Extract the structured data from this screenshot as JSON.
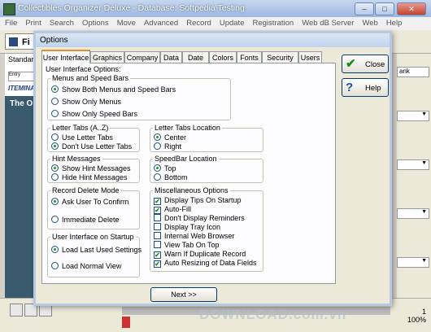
{
  "app": {
    "title": "Collectibles Organizer Deluxe - Database: Softpedia Testing",
    "window_buttons": [
      "–",
      "□",
      "✕"
    ],
    "menu": [
      "File",
      "Print",
      "Search",
      "Options",
      "Move",
      "Advanced",
      "Record",
      "Update",
      "Registration",
      "Web dB Server",
      "Web",
      "Help"
    ],
    "toolbar_fbtn_label": "Fi",
    "left_standard": "Standarc",
    "left_entry": "Entry",
    "left_itemnav": "ITEMINA",
    "left_dark_title": "The O",
    "right_rank": "ank",
    "zoom_level": "1\n100%"
  },
  "dialog": {
    "title": "Options",
    "tabs": [
      "User Interface",
      "Graphics",
      "Company",
      "Data",
      "Date",
      "Colors",
      "Fonts",
      "Security",
      "Users"
    ],
    "active_tab": "User Interface",
    "pane_caption": "User Interface Options:",
    "groups": {
      "menus": {
        "label": "Menus and Speed Bars",
        "options": [
          "Show Both Menus and Speed Bars",
          "Show Only Menus",
          "Show Only Speed Bars"
        ],
        "selected": 0
      },
      "letter_tabs": {
        "label": "Letter Tabs (A..Z)",
        "options": [
          "Use Letter Tabs",
          "Don't Use Letter Tabs"
        ],
        "selected": 1
      },
      "letter_tabs_location": {
        "label": "Letter Tabs Location",
        "options": [
          "Center",
          "Right"
        ],
        "selected": 0
      },
      "hint_messages": {
        "label": "Hint Messages",
        "options": [
          "Show Hint Messages",
          "Hide Hint Messages"
        ],
        "selected": 0
      },
      "speedbar_location": {
        "label": "SpeedBar Location",
        "options": [
          "Top",
          "Bottom"
        ],
        "selected": 0
      },
      "record_delete": {
        "label": "Record Delete Mode",
        "options": [
          "Ask User To Confirm",
          "Immediate Delete"
        ],
        "selected": 0
      },
      "startup": {
        "label": "User Interface on Startup",
        "options": [
          "Load Last Used Settings",
          "Load Normal View"
        ],
        "selected": 0
      },
      "misc": {
        "label": "Miscellaneous Options",
        "options": [
          {
            "label": "Display Tips On Startup",
            "checked": true
          },
          {
            "label": "Auto-Fill",
            "checked": true
          },
          {
            "label": "Don't Display Reminders",
            "checked": false
          },
          {
            "label": "Display Tray Icon",
            "checked": false
          },
          {
            "label": "Internal Web Browser",
            "checked": false
          },
          {
            "label": "View Tab On Top",
            "checked": false
          },
          {
            "label": "Warn If Duplicate Record",
            "checked": true
          },
          {
            "label": "Auto Resizing of Data Fields",
            "checked": true
          }
        ]
      }
    },
    "close_label": "Close",
    "help_label": "Help",
    "next_label": "Next >>",
    "watermark": "DOWNLOAD.com.vn"
  },
  "colors": {
    "accent": "#e68b2c",
    "check": "#1a8c1a",
    "help_icon": "#1a4fb0"
  }
}
